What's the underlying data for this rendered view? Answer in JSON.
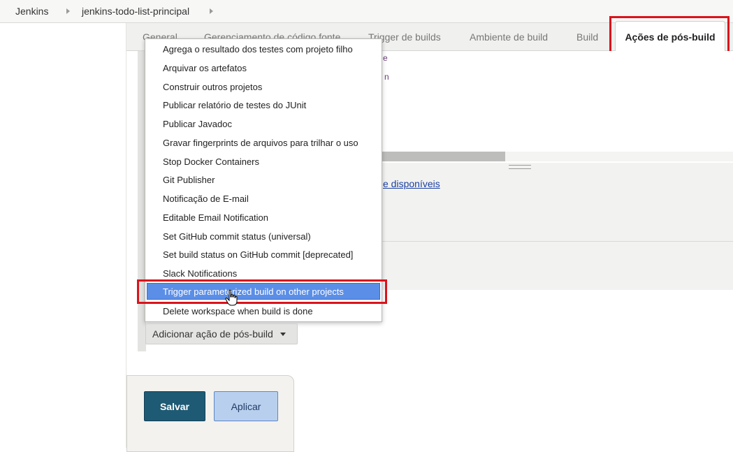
{
  "breadcrumb": {
    "items": [
      "Jenkins",
      "jenkins-todo-list-principal"
    ]
  },
  "tabs": {
    "items": [
      "General",
      "Gerenciamento de código fonte",
      "Trigger de builds",
      "Ambiente de build",
      "Build"
    ],
    "active": "Ações de pós-build"
  },
  "background": {
    "link_fragment": "e disponíveis",
    "fragment_1": "e",
    "fragment_2": "n"
  },
  "menu": {
    "items": [
      "Agrega o resultado dos testes com projeto filho",
      "Arquivar os artefatos",
      "Construir outros projetos",
      "Publicar relatório de testes do JUnit",
      "Publicar Javadoc",
      "Gravar fingerprints de arquivos para trilhar o uso",
      "Stop Docker Containers",
      "Git Publisher",
      "Notificação de E-mail",
      "Editable Email Notification",
      "Set GitHub commit status (universal)",
      "Set build status on GitHub commit [deprecated]",
      "Slack Notifications",
      "Trigger parameterized build on other projects",
      "Delete workspace when build is done"
    ],
    "selected_index": 13
  },
  "add_action": {
    "label": "Adicionar ação de pós-build"
  },
  "footer": {
    "save_label": "Salvar",
    "apply_label": "Aplicar"
  },
  "colors": {
    "highlight": "#d9141b",
    "selected": "#5b8ee6",
    "save": "#1e5a74"
  },
  "icons": [
    "chevron-right-icon",
    "caret-down-icon",
    "hand-cursor-icon"
  ]
}
